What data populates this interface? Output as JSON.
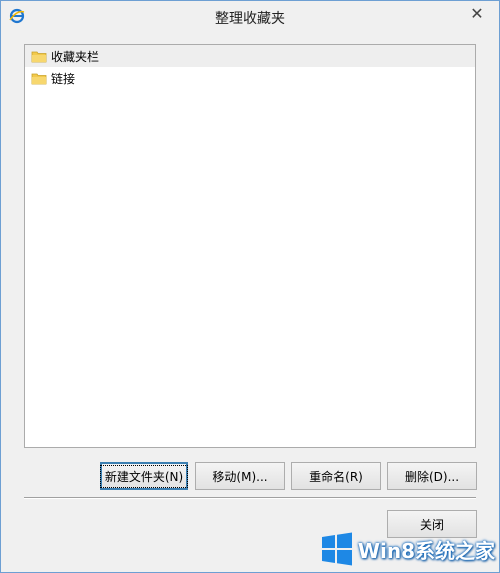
{
  "window": {
    "title": "整理收藏夹",
    "close_glyph": "✕"
  },
  "tree": {
    "items": [
      {
        "label": "收藏夹栏",
        "icon": "folder-icon",
        "selected": true
      },
      {
        "label": "链接",
        "icon": "folder-icon",
        "selected": false
      }
    ]
  },
  "buttons": {
    "new_folder": "新建文件夹(N)",
    "move": "移动(M)...",
    "rename": "重命名(R)",
    "delete": "删除(D)...",
    "close": "关闭"
  },
  "watermark": {
    "text": "Win8系统之家"
  },
  "colors": {
    "window_border": "#6d9fd3",
    "default_button_border": "#3c7fb1",
    "folder_yellow": "#f2c94c",
    "logo_blue": "#1e88e5"
  }
}
